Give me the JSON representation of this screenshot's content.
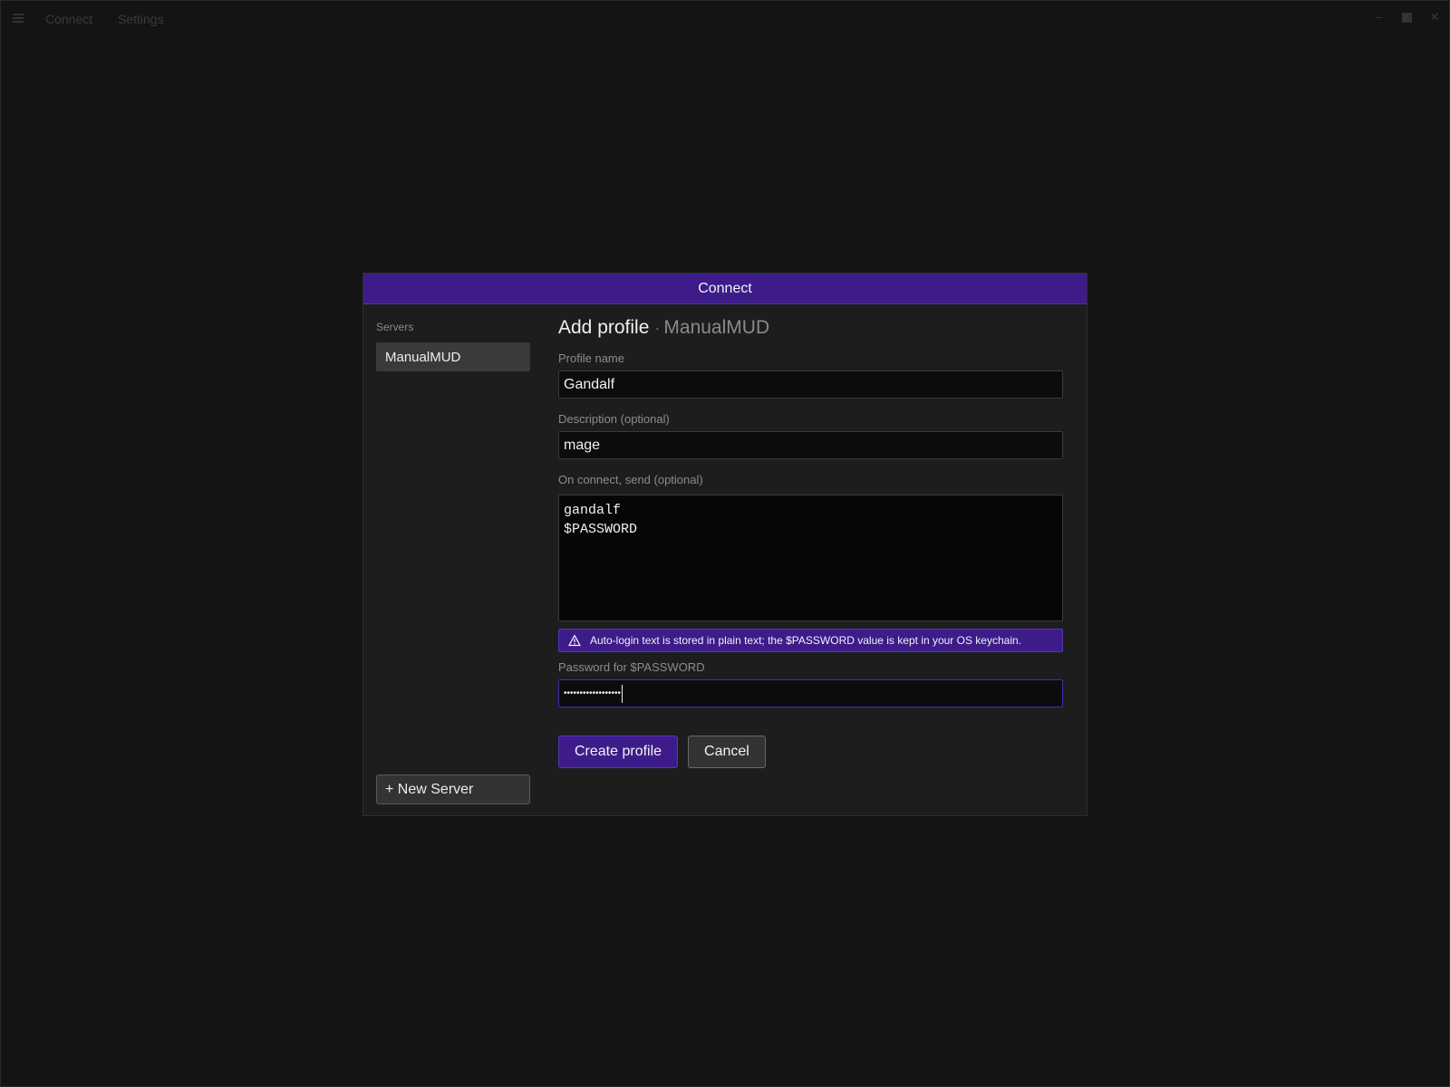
{
  "titlebar": {
    "menu": [
      "Connect",
      "Settings"
    ],
    "controls": [
      "minimize-icon",
      "maximize-icon",
      "close-icon"
    ]
  },
  "modal": {
    "title": "Connect",
    "sidebar": {
      "title": "Servers",
      "servers": [
        "ManualMUD"
      ],
      "new_server_label": "+ New Server"
    },
    "heading": {
      "title": "Add profile",
      "separator": "·",
      "server": "ManualMUD"
    },
    "fields": {
      "profile_name_label": "Profile name",
      "profile_name_value": "Gandalf",
      "description_label": "Description (optional)",
      "description_value": "mage",
      "on_connect_label": "On connect, send (optional)",
      "on_connect_value": "gandalf\n$PASSWORD",
      "password_label": "Password for $PASSWORD",
      "password_value": "••••••••••••••••••"
    },
    "warning": {
      "icon": "warning-triangle-icon",
      "text": "Auto-login text is stored in plain text; the $PASSWORD value is kept in your OS keychain."
    },
    "actions": {
      "create_label": "Create profile",
      "cancel_label": "Cancel"
    }
  },
  "colors": {
    "accent": "#3d1c8a",
    "background": "#141414",
    "panel": "#1d1d1d"
  }
}
